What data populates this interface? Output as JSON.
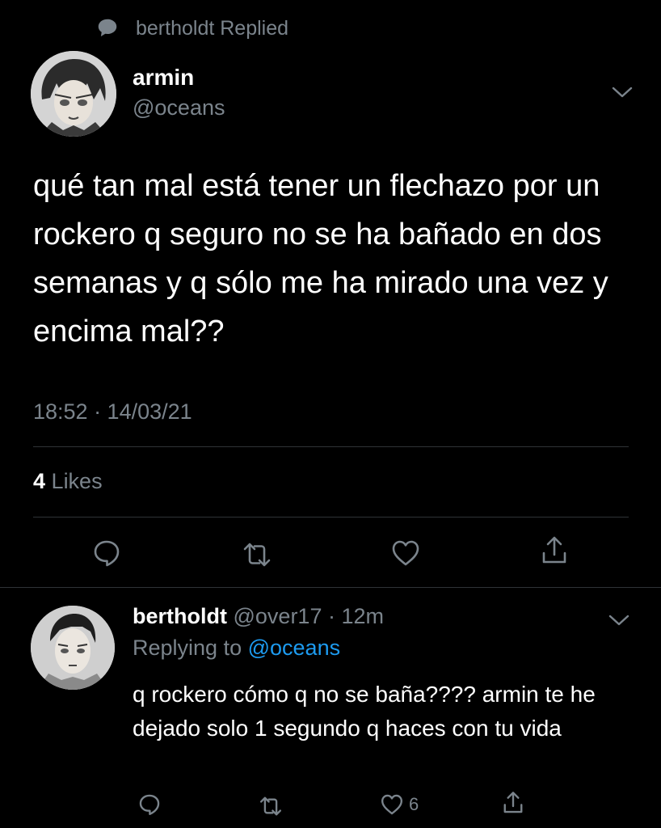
{
  "context": {
    "text": "bertholdt Replied"
  },
  "main_tweet": {
    "display_name": "armin",
    "handle": "@oceans",
    "text": "qué tan mal está tener un flechazo por un rockero q seguro no se ha bañado en dos semanas y q sólo me ha mirado una vez y encima mal??",
    "timestamp": "18:52 · 14/03/21",
    "likes_count": "4",
    "likes_label": "Likes"
  },
  "reply": {
    "display_name": "bertholdt",
    "meta": "@over17 · 12m",
    "replying_prefix": "Replying to",
    "replying_handle": "@oceans",
    "text": "q rockero cómo q no se baña???? armin te he dejado solo 1 segundo q haces con tu vida",
    "like_count": "6"
  },
  "colors": {
    "background": "#000000",
    "primary_text": "#ffffff",
    "secondary_text": "#7b848c",
    "link": "#1d9bf0",
    "divider": "#2f3336"
  },
  "icons": {
    "context": "speech-bubble-icon",
    "menu": "chevron-down-icon",
    "reply": "reply-icon",
    "retweet": "retweet-icon",
    "like": "heart-icon",
    "share": "share-icon"
  }
}
